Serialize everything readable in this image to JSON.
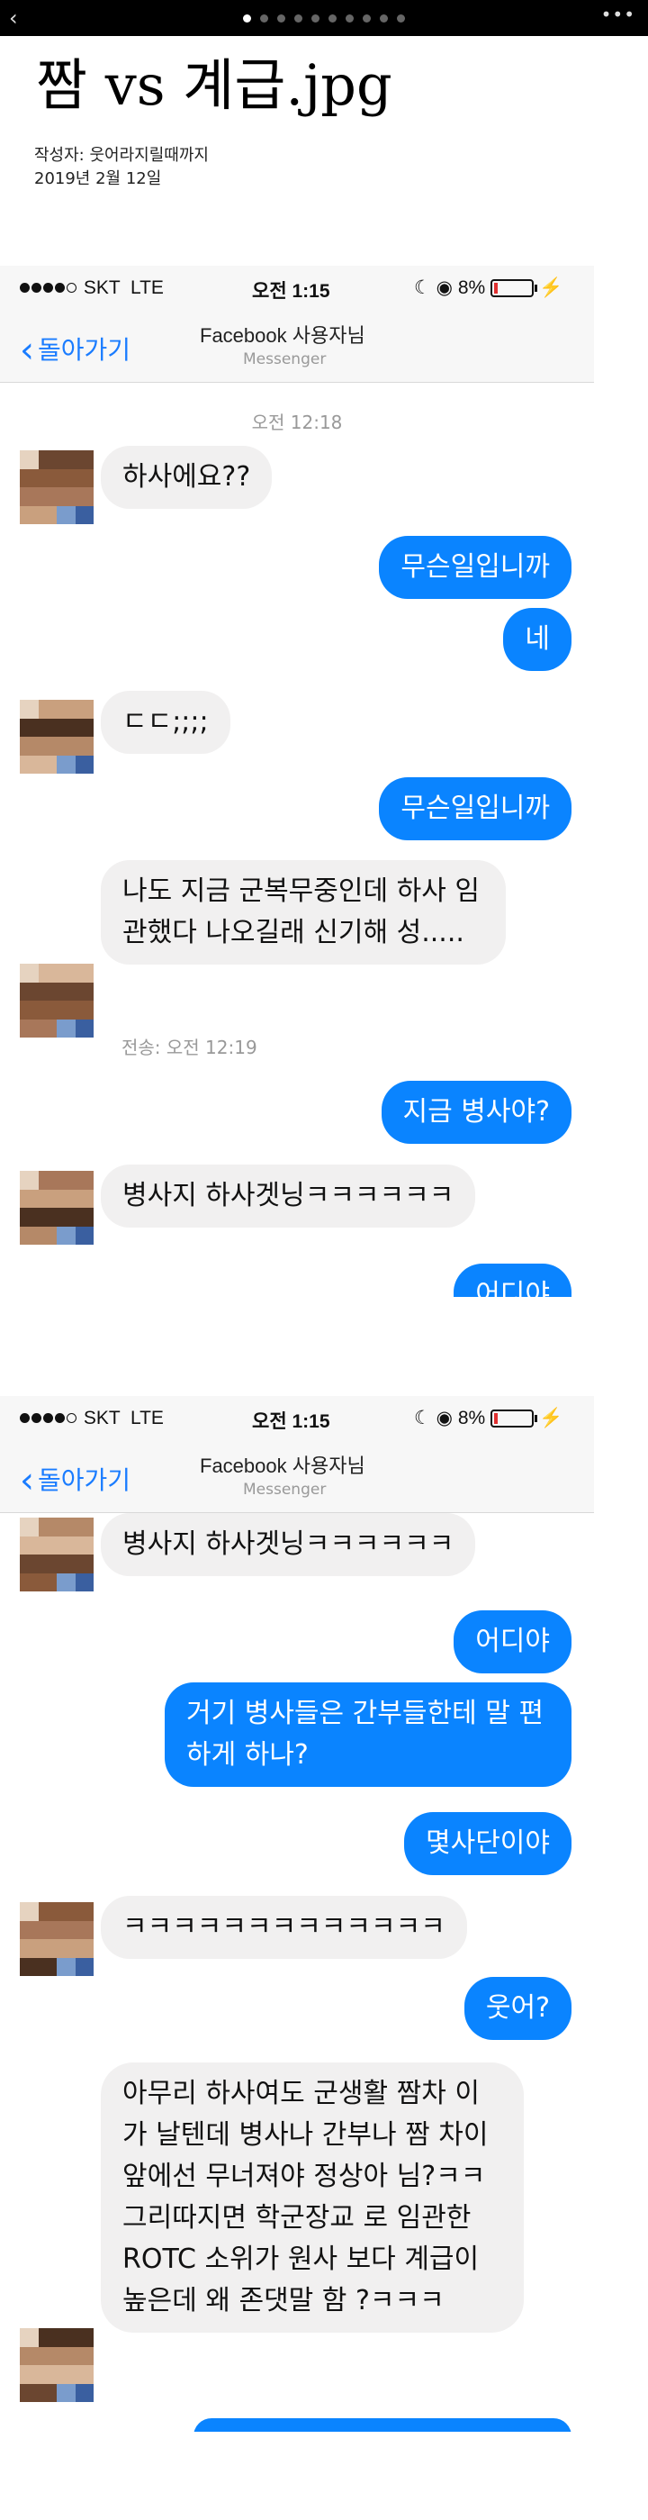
{
  "viewer": {
    "back_icon": "chevron-left-icon",
    "more_label": "•••",
    "page_count": 10,
    "active_index": 0
  },
  "post": {
    "title": "짬 vs 계급.jpg",
    "author": "작성자: 웃어라지릴때까지",
    "date": "2019년 2월 12일"
  },
  "statusbar": {
    "carrier": "SKT",
    "network": "LTE",
    "time": "오전 1:15",
    "battery": "8%"
  },
  "navbar": {
    "back_label": "돌아가기",
    "contact_name": "Facebook 사용자님",
    "contact_sub": "Messenger"
  },
  "shot1": {
    "timestamp": "오전 12:18",
    "messages": [
      {
        "dir": "in",
        "text": "하사에요??"
      },
      {
        "dir": "out",
        "text": "무슨일입니까"
      },
      {
        "dir": "out",
        "text": "네"
      },
      {
        "dir": "in",
        "text": "ㄷㄷ;;;;"
      },
      {
        "dir": "out",
        "text": "무슨일입니까"
      },
      {
        "dir": "in",
        "text": "나도 지금 군복무중인데 하사 임관했다 나오길래 신기해 성....."
      },
      {
        "dir": "out",
        "text": "지금 병사야?"
      },
      {
        "dir": "in",
        "text": "병사지 하사겟닝ㅋㅋㅋㅋㅋㅋ"
      },
      {
        "dir": "out",
        "text": "어디야"
      }
    ],
    "sent_label": "전송: 오전 12:19"
  },
  "shot2": {
    "messages": [
      {
        "dir": "in",
        "text": "병사지 하사겟닝ㅋㅋㅋㅋㅋㅋ"
      },
      {
        "dir": "out",
        "text": "어디야"
      },
      {
        "dir": "out",
        "text": "거기 병사들은 간부들한테 말 편하게 하나?"
      },
      {
        "dir": "out",
        "text": "몇사단이야"
      },
      {
        "dir": "in",
        "text": "ㅋㅋㅋㅋㅋㅋㅋㅋㅋㅋㅋㅋㅋ"
      },
      {
        "dir": "out",
        "text": "웃어?"
      },
      {
        "dir": "in",
        "text": "아무리 하사여도 군생활 짬차 이가 날텐데 병사나 간부나 짬 차이 앞에선 무너져야 정상아 님?ㅋㅋ 그리따지면 학군장교 로 임관한 ROTC 소위가 원사 보다 계급이 높은데 왜 존댓말 함 ?ㅋㅋㅋ"
      }
    ]
  }
}
